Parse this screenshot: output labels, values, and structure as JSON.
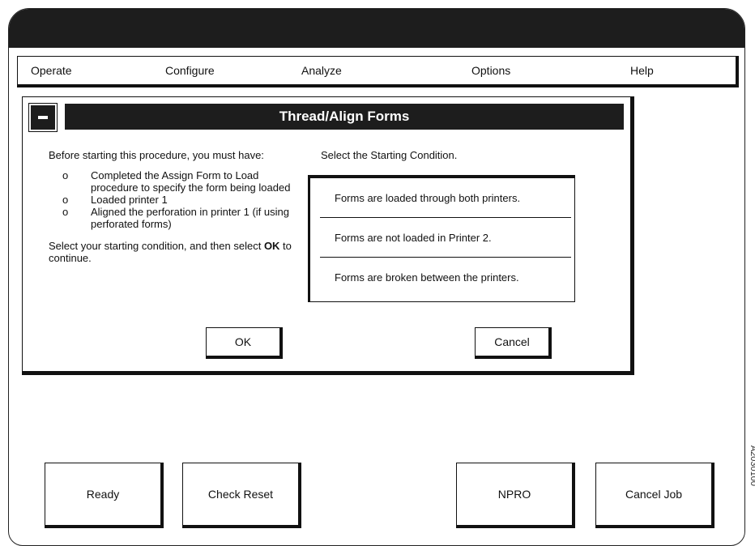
{
  "menu": [
    "Operate",
    "Configure",
    "Analyze",
    "Options",
    "Help"
  ],
  "dialog": {
    "title": "Thread/Align Forms",
    "intro": "Before starting this procedure, you must have:",
    "bullet_mark": "o",
    "bullets": [
      "Completed the Assign Form to Load procedure to specify the form being loaded",
      "Loaded printer 1",
      "Aligned the perforation in printer 1 (if using perforated forms)"
    ],
    "closing_prefix": "Select your starting condition, and then select ",
    "closing_bold": "OK",
    "closing_suffix": " to continue.",
    "condition_label": "Select the Starting Condition.",
    "conditions": [
      "Forms are loaded through both printers.",
      "Forms are not loaded in Printer 2.",
      "Forms are broken between the printers."
    ],
    "ok_label": "OK",
    "cancel_label": "Cancel"
  },
  "bottom_buttons": [
    "Ready",
    "Check Reset",
    "NPRO",
    "Cancel Job"
  ],
  "figure_code": "A2030100"
}
